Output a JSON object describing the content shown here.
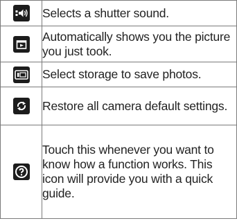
{
  "settings": [
    {
      "icon": "shutter-sound-icon",
      "description": "Selects a shutter sound."
    },
    {
      "icon": "auto-review-icon",
      "description": "Automatically shows you the picture you just took."
    },
    {
      "icon": "storage-icon",
      "description": "Select storage to save photos."
    },
    {
      "icon": "reset-icon",
      "description": "Restore all camera default settings."
    },
    {
      "icon": "help-guide-icon",
      "description": "Touch this whenever you want to know how a function works. This icon will provide you with a quick guide."
    }
  ]
}
